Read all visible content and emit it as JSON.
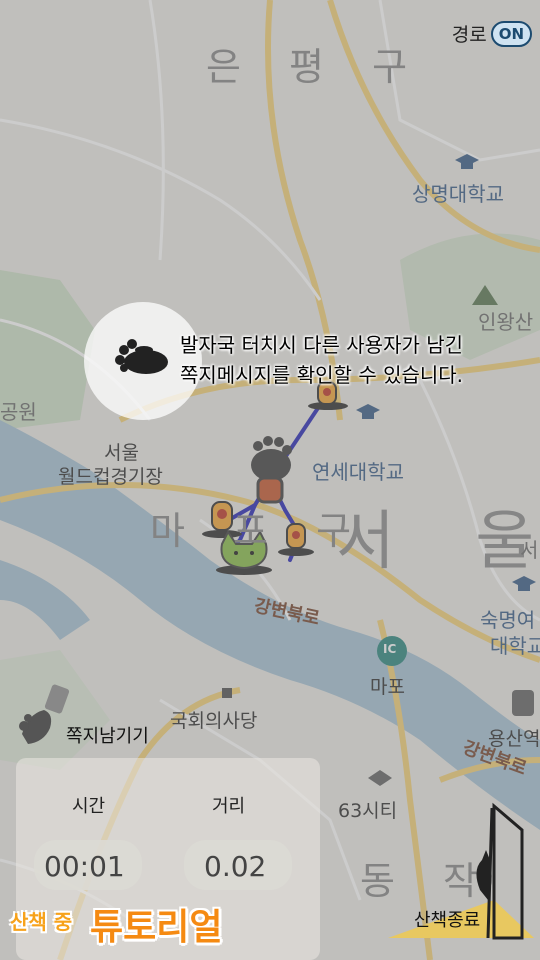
{
  "route_toggle": {
    "label": "경로",
    "state": "ON"
  },
  "map": {
    "district_top": "은 평 구",
    "district_center": "마 포 구",
    "city": "서 울",
    "dong_bottom": "동 작",
    "labels": {
      "sangmyung": "상명대학교",
      "yonsei": "연세대학교",
      "sookmyung_1": "숙명여",
      "sookmyung_2": "대학교",
      "inwangsan": "인왕산",
      "park": "공원",
      "stadium_1": "서울",
      "stadium_2": "월드컵경기장",
      "river_road": "강변북로",
      "river_road_2": "강변북로",
      "mapo": "마포",
      "ic": "IC",
      "assembly": "국회의사당",
      "sixtythree": "63시티",
      "yongsan": "용산역",
      "seo": "서"
    }
  },
  "tutorial": {
    "message_line1": "발자국 터치시 다른 사용자가 남긴",
    "message_line2": "쪽지메시지를 확인할 수 있습니다."
  },
  "note_button": {
    "label": "쪽지남기기"
  },
  "stats": {
    "time_label": "시간",
    "distance_label": "거리",
    "time_value": "00:01",
    "distance_value": "0.02"
  },
  "footer": {
    "mode": "산책 중",
    "title": "튜토리얼"
  },
  "end_button": {
    "label": "산책종료"
  },
  "colors": {
    "route": "#2b2bb8",
    "accent": "#f58a12",
    "toggle": "#1c4b70"
  }
}
